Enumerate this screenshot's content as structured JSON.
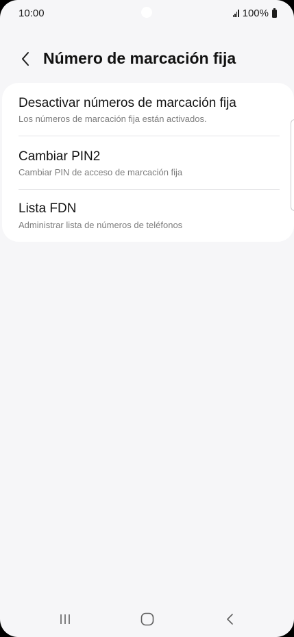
{
  "status_bar": {
    "time": "10:00",
    "battery": "100%",
    "icons": [
      "signal-icon",
      "battery-icon"
    ]
  },
  "header": {
    "back_icon": "chevron-left-icon",
    "title": "Número de marcación fija"
  },
  "settings": {
    "items": [
      {
        "title": "Desactivar números de marcación fija",
        "subtitle": "Los números de marcación fija están activados."
      },
      {
        "title": "Cambiar PIN2",
        "subtitle": "Cambiar PIN de acceso de marcación fija"
      },
      {
        "title": "Lista FDN",
        "subtitle": "Administrar lista de números de teléfonos"
      }
    ]
  },
  "nav_bar": {
    "icons": [
      "recent-apps-icon",
      "home-icon",
      "back-icon"
    ]
  },
  "colors": {
    "background": "#f6f6f8",
    "card": "#ffffff",
    "title_text": "#111111",
    "subtitle_text": "#7d7d7d",
    "divider": "#e4e4e6"
  }
}
